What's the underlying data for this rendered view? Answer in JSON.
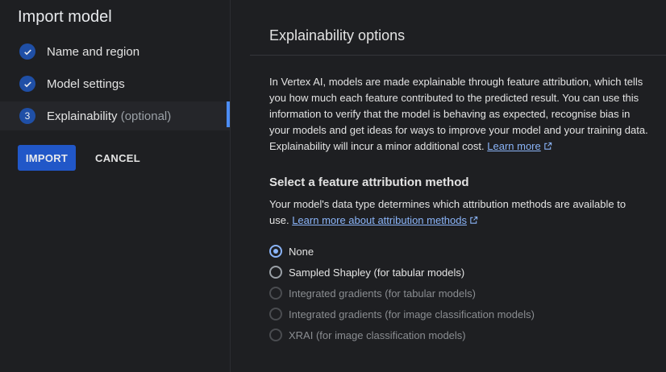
{
  "sidebar": {
    "title": "Import model",
    "steps": [
      {
        "label": "Name and region",
        "state": "complete"
      },
      {
        "label": "Model settings",
        "state": "complete"
      },
      {
        "label": "Explainability",
        "optional": "(optional)",
        "number": "3",
        "state": "active"
      }
    ],
    "import_label": "IMPORT",
    "cancel_label": "CANCEL"
  },
  "main": {
    "section_title": "Explainability options",
    "description": "In Vertex AI, models are made explainable through feature attribution, which tells you how much each feature contributed to the predicted result. You can use this information to verify that the model is behaving as expected, recognise bias in your models and get ideas for ways to improve your model and your training data. Explainability will incur a minor additional cost.",
    "learn_more": "Learn more",
    "attribution_heading": "Select a feature attribution method",
    "attribution_desc": "Your model's data type determines which attribution methods are available to use.",
    "attribution_link": "Learn more about attribution methods",
    "options": [
      {
        "label": "None",
        "checked": true,
        "disabled": false
      },
      {
        "label": "Sampled Shapley (for tabular models)",
        "checked": false,
        "disabled": false
      },
      {
        "label": "Integrated gradients (for tabular models)",
        "checked": false,
        "disabled": true
      },
      {
        "label": "Integrated gradients (for image classification models)",
        "checked": false,
        "disabled": true
      },
      {
        "label": "XRAI (for image classification models)",
        "checked": false,
        "disabled": true
      }
    ]
  },
  "colors": {
    "background": "#1e1f22",
    "accent": "#8ab4f8",
    "primary_button": "#2157c8",
    "step_marker": "#1f4fa6"
  }
}
